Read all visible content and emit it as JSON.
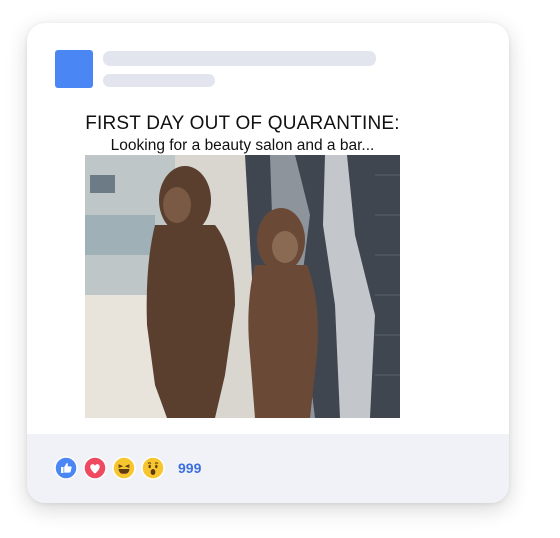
{
  "post": {
    "meme_title": "FIRST DAY OUT OF QUARANTINE:",
    "meme_subtitle": "Looking for a beauty salon and a bar...",
    "photo_subject": "two hominid museum figures"
  },
  "reactions": {
    "icons": [
      "like-icon",
      "love-icon",
      "haha-icon",
      "wow-icon"
    ],
    "count": "999",
    "colors": {
      "like": "#4b86f5",
      "love": "#ef4a5f",
      "haha": "#f7c62e",
      "wow": "#f7c62e",
      "count": "#3b6fe0"
    }
  },
  "colors": {
    "avatar": "#4b86f5",
    "skeleton": "#e2e4ee",
    "footer": "#f0f2f7"
  }
}
